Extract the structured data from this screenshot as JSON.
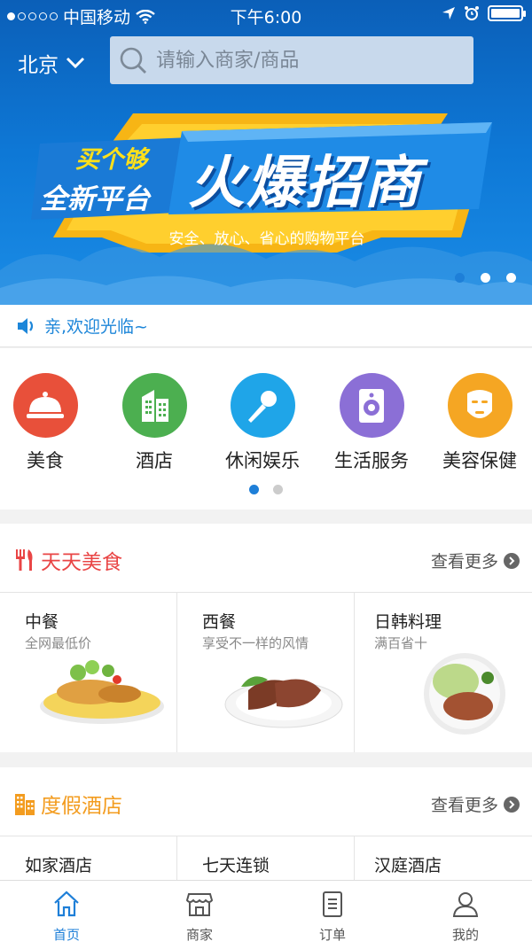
{
  "status": {
    "carrier": "中国移动",
    "time": "下午6:00"
  },
  "header": {
    "city": "北京",
    "search_placeholder": "请输入商家/商品"
  },
  "banner": {
    "tag1": "买个够",
    "tag2": "全新平台",
    "title": "火爆招商",
    "subtitle": "安全、放心、省心的购物平台"
  },
  "notice": {
    "text": "亲,欢迎光临~"
  },
  "categories": [
    {
      "label": "美食",
      "color": "#e8503a",
      "icon": "food-cloche-icon"
    },
    {
      "label": "酒店",
      "color": "#4caf50",
      "icon": "building-icon"
    },
    {
      "label": "休闲娱乐",
      "color": "#1fa5e8",
      "icon": "microphone-icon"
    },
    {
      "label": "生活服务",
      "color": "#8b6fd6",
      "icon": "speaker-icon"
    },
    {
      "label": "美容保健",
      "color": "#f5a623",
      "icon": "face-mask-icon"
    }
  ],
  "food_section": {
    "title": "天天美食",
    "more": "查看更多",
    "color": "#e94545",
    "items": [
      {
        "name": "中餐",
        "desc": "全网最低价"
      },
      {
        "name": "西餐",
        "desc": "享受不一样的风情"
      },
      {
        "name": "日韩料理",
        "desc": "满百省十"
      }
    ]
  },
  "hotel_section": {
    "title": "度假酒店",
    "more": "查看更多",
    "color": "#f39c1f",
    "items": [
      {
        "name": "如家酒店"
      },
      {
        "name": "七天连锁"
      },
      {
        "name": "汉庭酒店"
      }
    ]
  },
  "tabbar": [
    {
      "label": "首页",
      "icon": "home-icon",
      "active": true
    },
    {
      "label": "商家",
      "icon": "store-icon",
      "active": false
    },
    {
      "label": "订单",
      "icon": "order-icon",
      "active": false
    },
    {
      "label": "我的",
      "icon": "user-icon",
      "active": false
    }
  ]
}
